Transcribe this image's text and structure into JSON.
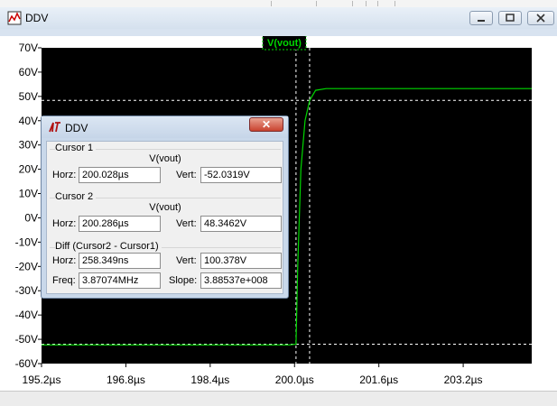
{
  "window": {
    "title": "DDV"
  },
  "trace": {
    "label": "V(vout)",
    "color": "#00d800"
  },
  "axes": {
    "y_ticks": [
      "70V",
      "60V",
      "50V",
      "40V",
      "30V",
      "20V",
      "10V",
      "0V",
      "-10V",
      "-20V",
      "-30V",
      "-40V",
      "-50V",
      "-60V"
    ],
    "x_ticks": [
      "195.2µs",
      "196.8µs",
      "198.4µs",
      "200.0µs",
      "201.6µs",
      "203.2µs"
    ]
  },
  "chart_data": {
    "type": "line",
    "title": "V(vout)",
    "xlabel": "",
    "ylabel": "",
    "xlim": [
      195.2,
      204.5
    ],
    "ylim": [
      -60,
      70
    ],
    "x_unit": "µs",
    "y_unit": "V",
    "grid": false,
    "series": [
      {
        "name": "V(vout)",
        "x": [
          195.2,
          199.9,
          200.028,
          200.06,
          200.12,
          200.2,
          200.286,
          200.4,
          200.6,
          204.5
        ],
        "y": [
          -52.3,
          -52.3,
          -52.0,
          -20.0,
          20.0,
          40.0,
          48.35,
          52.5,
          53.2,
          53.2
        ]
      }
    ],
    "cursors": [
      {
        "name": "Cursor 1",
        "x": 200.028,
        "y": -52.0319
      },
      {
        "name": "Cursor 2",
        "x": 200.286,
        "y": 48.3462
      }
    ]
  },
  "dialog": {
    "title": "DDV",
    "close_glyph": "✕",
    "cursor1": {
      "title": "Cursor 1",
      "signal": "V(vout)",
      "horz_label": "Horz:",
      "horz": "200.028µs",
      "vert_label": "Vert:",
      "vert": "-52.0319V"
    },
    "cursor2": {
      "title": "Cursor 2",
      "signal": "V(vout)",
      "horz_label": "Horz:",
      "horz": "200.286µs",
      "vert_label": "Vert:",
      "vert": "48.3462V"
    },
    "diff": {
      "title": "Diff (Cursor2 - Cursor1)",
      "horz_label": "Horz:",
      "horz": "258.349ns",
      "vert_label": "Vert:",
      "vert": "100.378V",
      "freq_label": "Freq:",
      "freq": "3.87074MHz",
      "slope_label": "Slope:",
      "slope": "3.88537e+008"
    }
  }
}
